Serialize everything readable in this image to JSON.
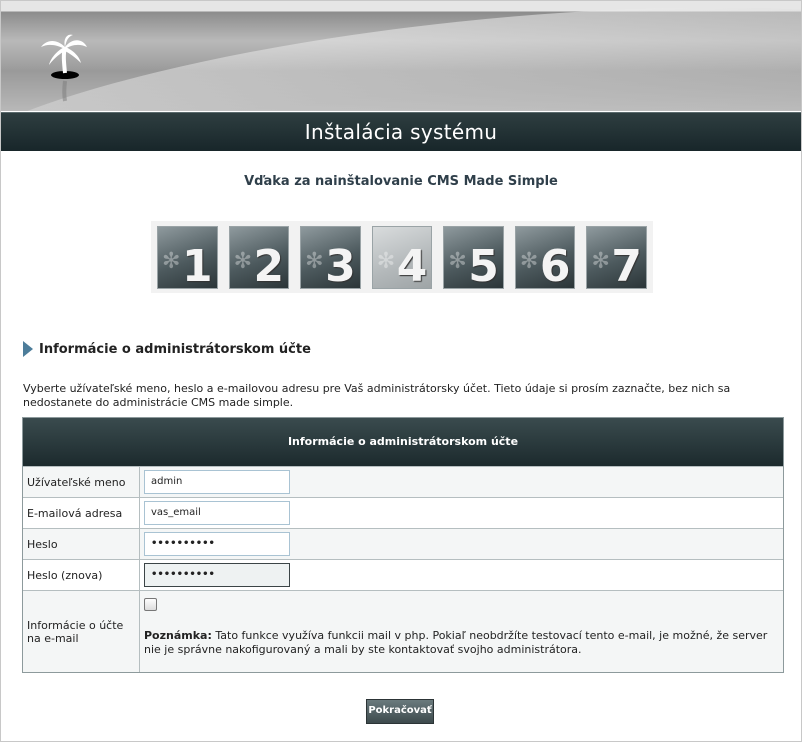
{
  "header": {
    "title": "Inštalácia systému"
  },
  "welcome": "Vďaka za nainštalovanie CMS Made Simple",
  "steps": {
    "items": [
      "1",
      "2",
      "3",
      "4",
      "5",
      "6",
      "7"
    ],
    "current": "4"
  },
  "section": {
    "title": "Informácie o administrátorskom účte",
    "intro": "Vyberte užívateľské meno, heslo a e-mailovou adresu pre Vaš administrátorsky účet. Tieto údaje si prosím zaznačte, bez nich sa nedostanete do administrácie CMS made simple."
  },
  "form": {
    "table_title": "Informácie o administrátorskom účte",
    "username_label": "Užívateľské meno",
    "username_value": "admin",
    "email_label": "E-mailová adresa",
    "email_value": "vas_email",
    "password_label": "Heslo",
    "password_value": "••••••••••",
    "password2_label": "Heslo (znova)",
    "password2_value": "••••••••••",
    "mail_label": "Informácie o účte na e-mail",
    "note_label": "Poznámka:",
    "note_text": " Tato funkce využíva funkcii mail v php. Pokiaľ neobdržíte testovací tento e-mail, je možné, že server nie je správne nakofigurovaný a mali by ste kontaktovať svojho administrátora."
  },
  "submit_label": "Pokračovať",
  "colors": {
    "dark_bar": "#1c2a2d",
    "accent_arrow": "#4d7d9a",
    "input_border": "#a9c3d3"
  }
}
